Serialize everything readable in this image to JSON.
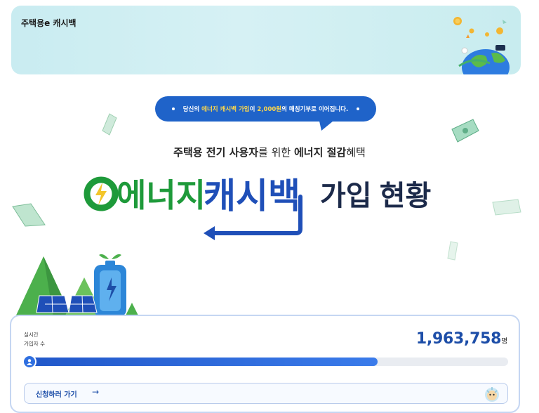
{
  "header": {
    "title": "주택용e 캐시백"
  },
  "bubble": {
    "text_pre": "당신의 ",
    "text_highlight_1": "에너지 캐시백 가입",
    "text_mid": "이 ",
    "text_highlight_2": "2,000원",
    "text_post": "의 매칭기부로 이어집니다."
  },
  "subtitle": {
    "part1": "주택용 전기 사용자",
    "part2": "를 위한 ",
    "part3": "에너지 절감",
    "part4": "혜택"
  },
  "hero": {
    "green_text": "에너지",
    "blue_text": "캐시백",
    "dark_text": "가입 현황"
  },
  "counter": {
    "label_line1": "실시간",
    "label_line2": "가입자 수",
    "value": "1,963,758",
    "unit": "명",
    "progress_fraction": 0.73
  },
  "apply": {
    "label": "신청하러 가기",
    "arrow": "→"
  },
  "colors": {
    "brand_blue": "#1f63c9",
    "brand_green": "#1e9a3a",
    "highlight_yellow": "#ffd84a"
  }
}
